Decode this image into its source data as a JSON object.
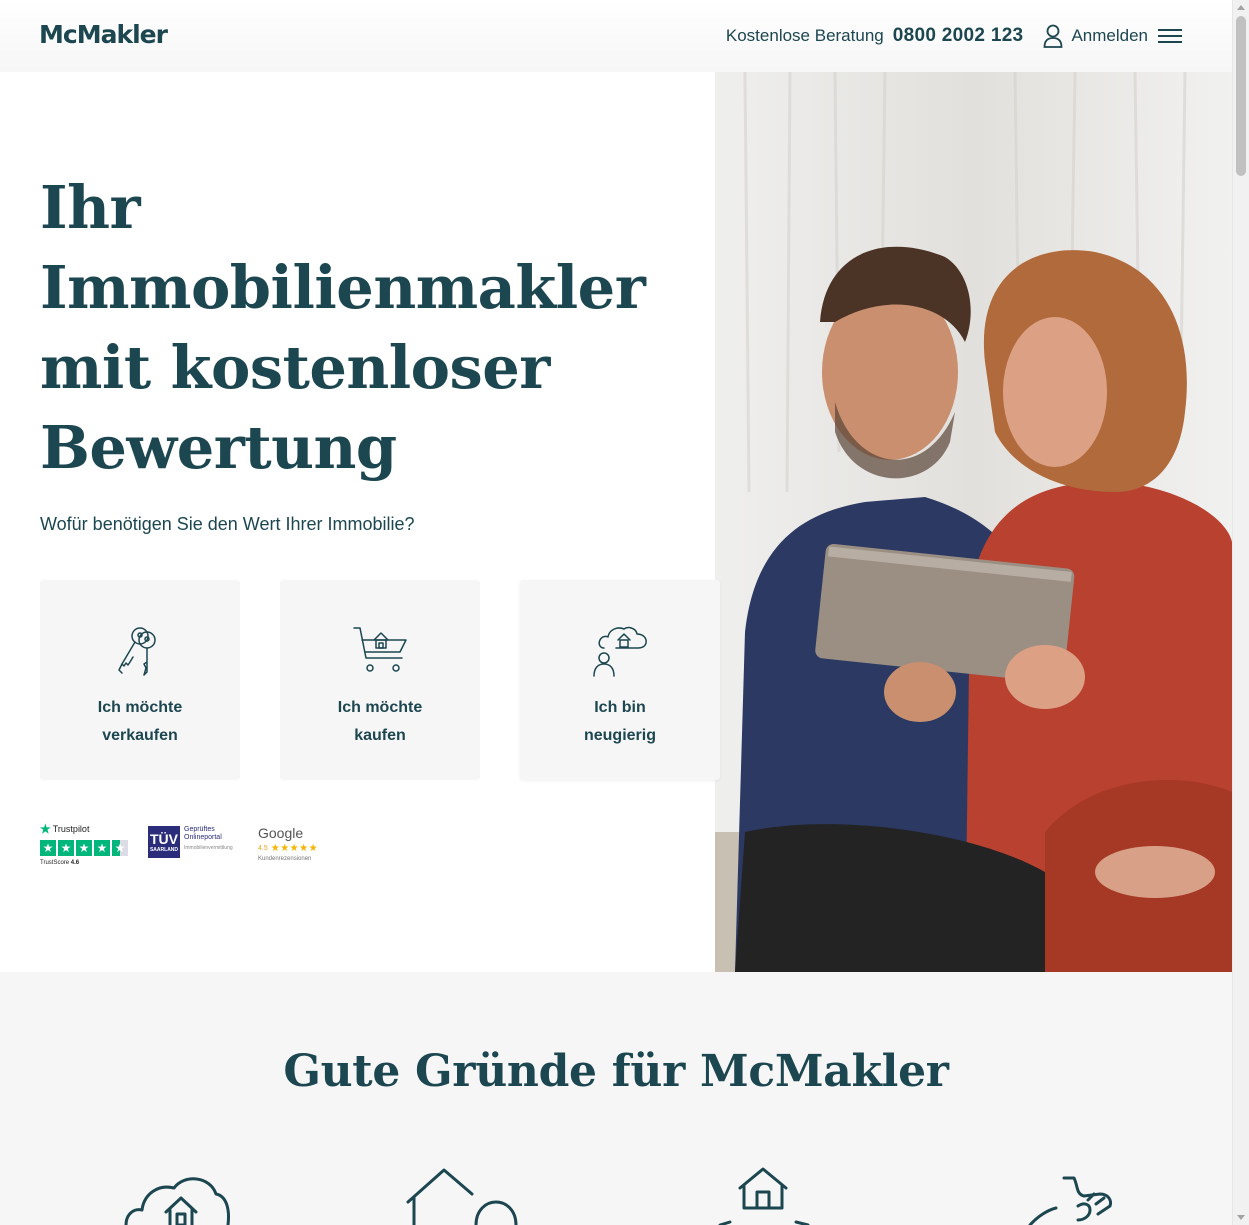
{
  "header": {
    "logo": "McMakler",
    "consult_label": "Kostenlose Beratung",
    "phone": "0800 2002 123",
    "login_label": "Anmelden",
    "icons": {
      "user": "user-icon",
      "menu": "hamburger-menu-icon"
    }
  },
  "hero": {
    "headline": [
      "Ihr",
      "Immobilienmakler",
      "mit kostenloser",
      "Bewertung"
    ],
    "question": "Wofür benötigen Sie den Wert Ihrer Immobilie?",
    "cards": [
      {
        "label": "Ich möchte verkaufen",
        "icon": "keys-icon"
      },
      {
        "label": "Ich möchte kaufen",
        "icon": "shopping-cart-house-icon"
      },
      {
        "label": "Ich bin neugierig",
        "icon": "person-cloud-house-icon"
      }
    ],
    "photo": "couple-with-tablet-photo"
  },
  "badges": {
    "trustpilot": {
      "name": "Trustpilot",
      "score_label": "TrustScore",
      "score": "4.6"
    },
    "tuv": {
      "mark": "TÜV",
      "region": "SAARLAND",
      "line1": "Geprüftes",
      "line2": "Onlineportal",
      "sub": "Immobilienvermittlung"
    },
    "google": {
      "name": "Google",
      "score": "4.5",
      "sub": "Kundenrezensionen"
    }
  },
  "reasons": {
    "title": "Gute Gründe für McMakler",
    "icons": [
      "cloud-house-icon",
      "houses-icon",
      "house-hand-icon",
      "hand-icon"
    ]
  },
  "colors": {
    "brand": "#1c4650",
    "card_bg": "#f6f6f6",
    "section_bg": "#f6f6f6",
    "trustpilot": "#00b67a"
  }
}
